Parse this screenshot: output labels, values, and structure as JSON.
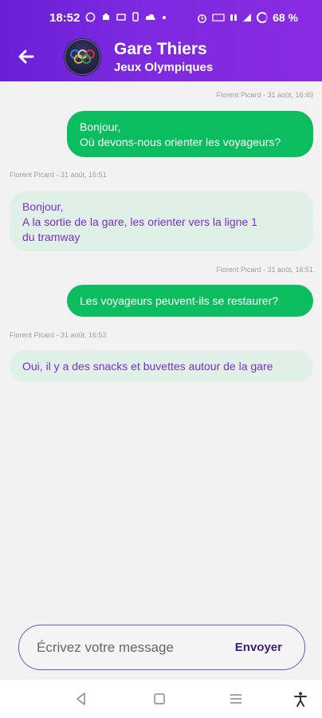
{
  "status_bar": {
    "time": "18:52",
    "battery": "68 %"
  },
  "header": {
    "title": "Gare Thiers",
    "subtitle": "Jeux Olympiques",
    "back_icon": "arrow-left-icon",
    "avatar_icon": "olympic-rings-icon"
  },
  "messages": [
    {
      "meta": "Florent Picard - 31 août, 16:49",
      "direction": "out",
      "text": "Bonjour,\nOù devons-nous orienter les voyageurs?"
    },
    {
      "meta": "Florent Picard - 31 août, 16:51",
      "direction": "in",
      "text": "Bonjour,\nA la sortie de la gare, les orienter vers la ligne 1\ndu tramway"
    },
    {
      "meta": "Florent Picard - 31 août, 16:51",
      "direction": "out",
      "text": "Les voyageurs peuvent-ils se restaurer?"
    },
    {
      "meta": "Florent Picard - 31 août, 16:52",
      "direction": "in",
      "text": "Oui, il y a des snacks et buvettes autour de la gare"
    }
  ],
  "composer": {
    "placeholder": "Écrivez votre message",
    "send_label": "Envoyer"
  },
  "nav": {
    "back_icon": "triangle-back-icon",
    "home_icon": "square-home-icon",
    "recents_icon": "menu-lines-icon",
    "accessibility_icon": "accessibility-icon"
  },
  "colors": {
    "header_start": "#6a1fd6",
    "header_end": "#8a2be2",
    "outgoing_bubble": "#0bbd5f",
    "incoming_bubble": "#dff0e7",
    "incoming_text": "#7a2fd0"
  }
}
